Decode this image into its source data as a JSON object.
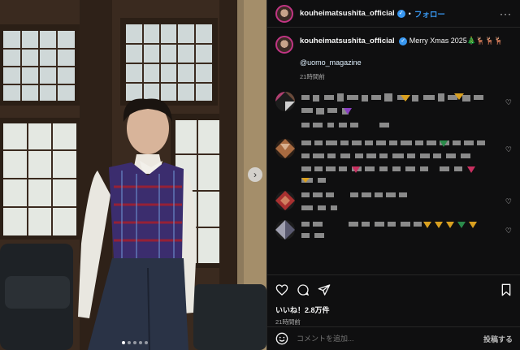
{
  "post": {
    "username": "kouheimatsushita_official",
    "follow_label": "フォロー",
    "separator": "•",
    "caption_text": "Merry Xmas 2025🎄🦌🦌🦌",
    "mention": "@uomo_magazine",
    "caption_time": "21時間前",
    "likes": "いいね！2.8万件",
    "post_time": "21時間前"
  },
  "comment_box": {
    "placeholder": "コメントを追加...",
    "post_label": "投稿する"
  },
  "carousel": {
    "count": 5,
    "active": 0
  },
  "colors": {
    "link": "#3897f0",
    "muted": "#a8a8a8",
    "bg": "#0f0f10"
  },
  "icons": [
    "heart-icon",
    "comment-icon",
    "share-icon",
    "bookmark-icon",
    "emoji-icon",
    "more-icon",
    "verified-icon",
    "chevron-right-icon"
  ]
}
